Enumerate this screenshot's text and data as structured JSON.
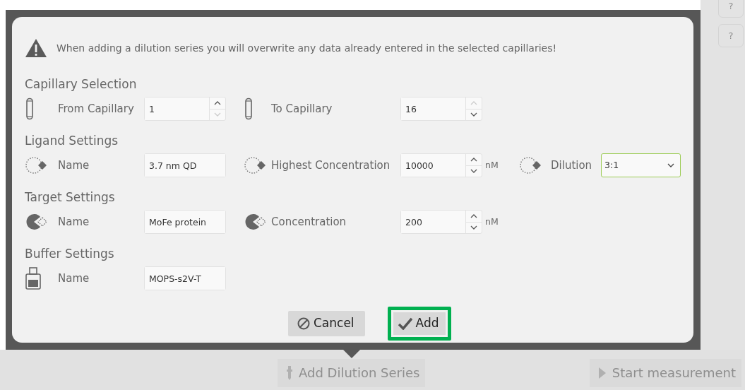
{
  "warning": {
    "text": "When adding a dilution series you will overwrite any data already entered in the selected capillaries!"
  },
  "sections": [
    {
      "title": "Capillary Selection",
      "fields": [
        {
          "label": "From Capillary",
          "kind": "spinner",
          "value": "1",
          "up_disabled": false,
          "down_disabled": true
        },
        {
          "label": "To Capillary",
          "kind": "spinner",
          "value": "16",
          "up_disabled": true,
          "down_disabled": false
        }
      ]
    },
    {
      "title": "Ligand Settings",
      "fields": [
        {
          "label": "Name",
          "kind": "text",
          "value": "3.7 nm QD"
        },
        {
          "label": "Highest Concentration",
          "kind": "spinner",
          "value": "10000",
          "unit": "nM",
          "up_disabled": false,
          "down_disabled": false
        },
        {
          "label": "Dilution",
          "kind": "select",
          "value": "3:1",
          "focused": true
        }
      ]
    },
    {
      "title": "Target Settings",
      "fields": [
        {
          "label": "Name",
          "kind": "text",
          "value": "MoFe protein"
        },
        {
          "label": "Concentration",
          "kind": "spinner",
          "value": "200",
          "unit": "nM",
          "up_disabled": false,
          "down_disabled": false
        }
      ]
    },
    {
      "title": "Buffer Settings",
      "fields": [
        {
          "label": "Name",
          "kind": "text",
          "value": "MOPS-s2V-T"
        }
      ]
    }
  ],
  "buttons": [
    {
      "label": "Cancel",
      "highlighted": false
    },
    {
      "label": "Add",
      "highlighted": true
    }
  ],
  "side_buttons": [
    {
      "label": "?"
    },
    {
      "label": "?"
    }
  ],
  "bottom_bar": [
    {
      "label": "Add Dilution Series",
      "disabled": true
    },
    {
      "label": "Start measurement",
      "disabled": true
    }
  ]
}
